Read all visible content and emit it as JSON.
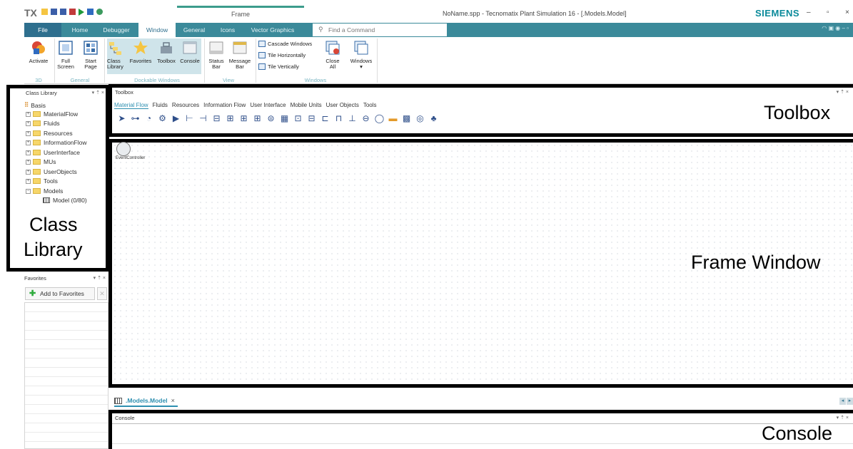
{
  "titlebar": {
    "logo": "TX",
    "frame_tab": "Frame",
    "window_title": "NoName.spp - Tecnomatix Plant Simulation 16 - [.Models.Model]",
    "brand": "SIEMENS",
    "minimize": "–",
    "restore": "▫",
    "close": "×"
  },
  "ribbon_tabs": {
    "file": "File",
    "home": "Home",
    "debugger": "Debugger",
    "window": "Window",
    "general": "General",
    "icons": "Icons",
    "vector_graphics": "Vector Graphics",
    "find_placeholder": "Find a Command"
  },
  "ribbon": {
    "activate": "Activate",
    "full_screen_1": "Full",
    "full_screen_2": "Screen",
    "start_page_1": "Start",
    "start_page_2": "Page",
    "class_library_1": "Class",
    "class_library_2": "Library",
    "favorites": "Favorites",
    "toolbox": "Toolbox",
    "console": "Console",
    "status_bar_1": "Status",
    "status_bar_2": "Bar",
    "message_bar_1": "Message",
    "message_bar_2": "Bar",
    "cascade_windows": "Cascade Windows",
    "tile_horizontally": "Tile Horizontally",
    "tile_vertically": "Tile Vertically",
    "close_all_1": "Close",
    "close_all_2": "All",
    "windows": "Windows",
    "windows_arrow": "▾",
    "group_3d": "3D",
    "group_general": "General",
    "group_dockable": "Dockable Windows",
    "group_view": "View",
    "group_windows": "Windows"
  },
  "class_library": {
    "header": "Class Library",
    "root": "Basis",
    "items": [
      "MaterialFlow",
      "Fluids",
      "Resources",
      "InformationFlow",
      "UserInterface",
      "MUs",
      "UserObjects",
      "Tools",
      "Models"
    ],
    "model_item": "Model (0/80)"
  },
  "favorites": {
    "header": "Favorites",
    "add_button": "Add to Favorites"
  },
  "toolbox": {
    "header": "Toolbox",
    "tabs": [
      "Material Flow",
      "Fluids",
      "Resources",
      "Information Flow",
      "User Interface",
      "Mobile Units",
      "User Objects",
      "Tools"
    ]
  },
  "frame": {
    "event_controller_label": "EventController"
  },
  "document_tab": {
    "label": ".Models.Model",
    "close": "×"
  },
  "console": {
    "header": "Console"
  },
  "annotations": {
    "toolbox": "Toolbox",
    "class_library_1": "Class",
    "class_library_2": "Library",
    "frame_window": "Frame Window",
    "console": "Console"
  },
  "panel_controls": "▾ ⇡ ×"
}
